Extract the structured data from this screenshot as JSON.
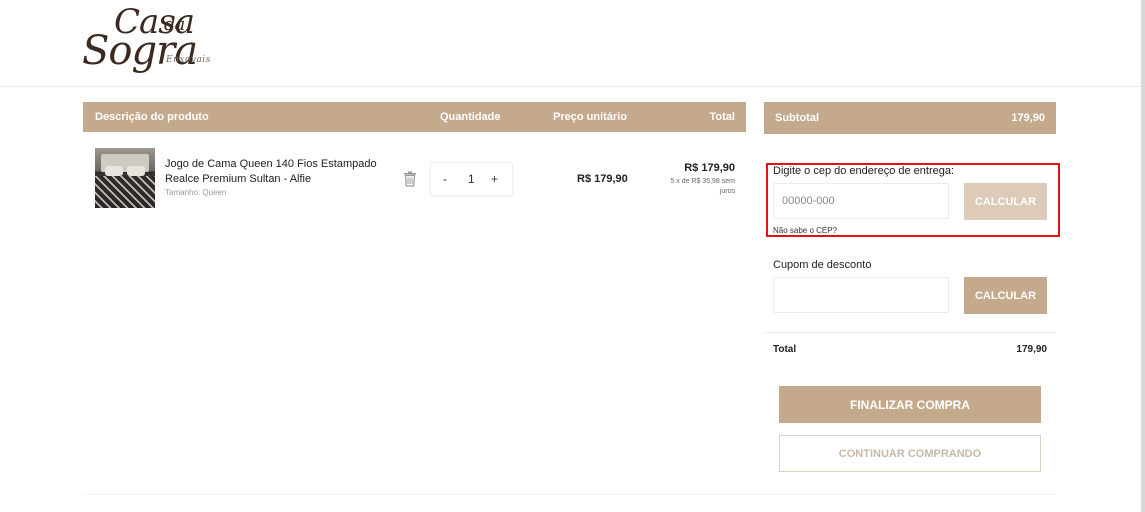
{
  "brand": {
    "logo_line1": "Casa",
    "logo_line1b": "da",
    "logo_line2": "Sogra",
    "logo_line3": "Enxovais"
  },
  "table": {
    "headers": {
      "description": "Descrição do produto",
      "quantity": "Quantidade",
      "unit_price": "Preço unitário",
      "total": "Total"
    },
    "items": [
      {
        "name": "Jogo de Cama Queen 140 Fios Estampado Realce Premium Sultan - Alfie",
        "variant": "Tamanho: Queen",
        "quantity": "1",
        "minus": "-",
        "plus": "+",
        "unit_price": "R$ 179,90",
        "total": "R$ 179,90",
        "installments": "5 x de R$ 35,98 sem juros"
      }
    ]
  },
  "summary": {
    "subtotal_label": "Subtotal",
    "subtotal_value": "179,90",
    "cep_label": "Digite o cep do endereço de entrega:",
    "cep_placeholder": "00000-000",
    "calc_label": "CALCULAR",
    "cep_help": "Não sabe o CEP?",
    "coupon_label": "Cupom de desconto",
    "coupon_placeholder": "",
    "coupon_button": "CALCULAR",
    "total_label": "Total",
    "total_value": "179,90",
    "finish_button": "FINALIZAR COMPRA",
    "continue_button": "CONTINUAR COMPRANDO"
  },
  "colors": {
    "accent": "#c4a98c",
    "accent_light": "#ddcab8",
    "highlight_border": "#e3111a"
  },
  "icons": {
    "trash": "trash-icon"
  }
}
